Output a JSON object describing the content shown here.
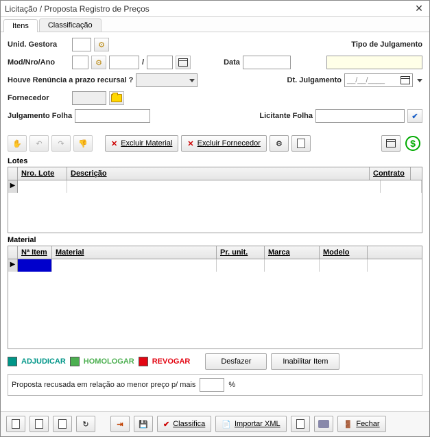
{
  "window": {
    "title": "Licitação / Proposta Registro de Preços",
    "close": "✕"
  },
  "tabs": {
    "itens": "Itens",
    "classificacao": "Classificação"
  },
  "form": {
    "unid_gestora_label": "Unid. Gestora",
    "mod_nro_ano_label": "Mod/Nro/Ano",
    "slash": "/",
    "data_label": "Data",
    "tipo_julgamento_label": "Tipo de Julgamento",
    "houve_renuncia_label": "Houve Renúncia a prazo recursal ?",
    "dt_julgamento_label": "Dt. Julgamento",
    "dt_julgamento_value": "__/__/____",
    "fornecedor_label": "Fornecedor",
    "julgamento_folha_label": "Julgamento Folha",
    "licitante_folha_label": "Licitante Folha"
  },
  "toolbar": {
    "excluir_material": "Excluir Material",
    "excluir_fornecedor": "Excluir Fornecedor"
  },
  "lotes": {
    "section": "Lotes",
    "cols": {
      "nro_lote": "Nro. Lote",
      "descricao": "Descrição",
      "contrato": "Contrato"
    }
  },
  "material": {
    "section": "Material",
    "cols": {
      "n_item": "Nª Item",
      "material_col": "Material",
      "pr_unit": "Pr. unit.",
      "marca": "Marca",
      "modelo": "Modelo"
    }
  },
  "legend": {
    "adjudicar": "ADJUDICAR",
    "homologar": "HOMOLOGAR",
    "revogar": "REVOGAR",
    "desfazer": "Desfazer",
    "inabilitar": "Inabilitar Item"
  },
  "proposta": {
    "label": "Proposta recusada em relação ao menor preço p/ mais",
    "suffix": "%"
  },
  "bottom": {
    "classifica": "Classifica",
    "importar_xml": "Importar XML",
    "fechar": "Fechar"
  },
  "colors": {
    "adjudicar": "#009688",
    "homologar": "#4caf50",
    "revogar": "#e30613"
  }
}
